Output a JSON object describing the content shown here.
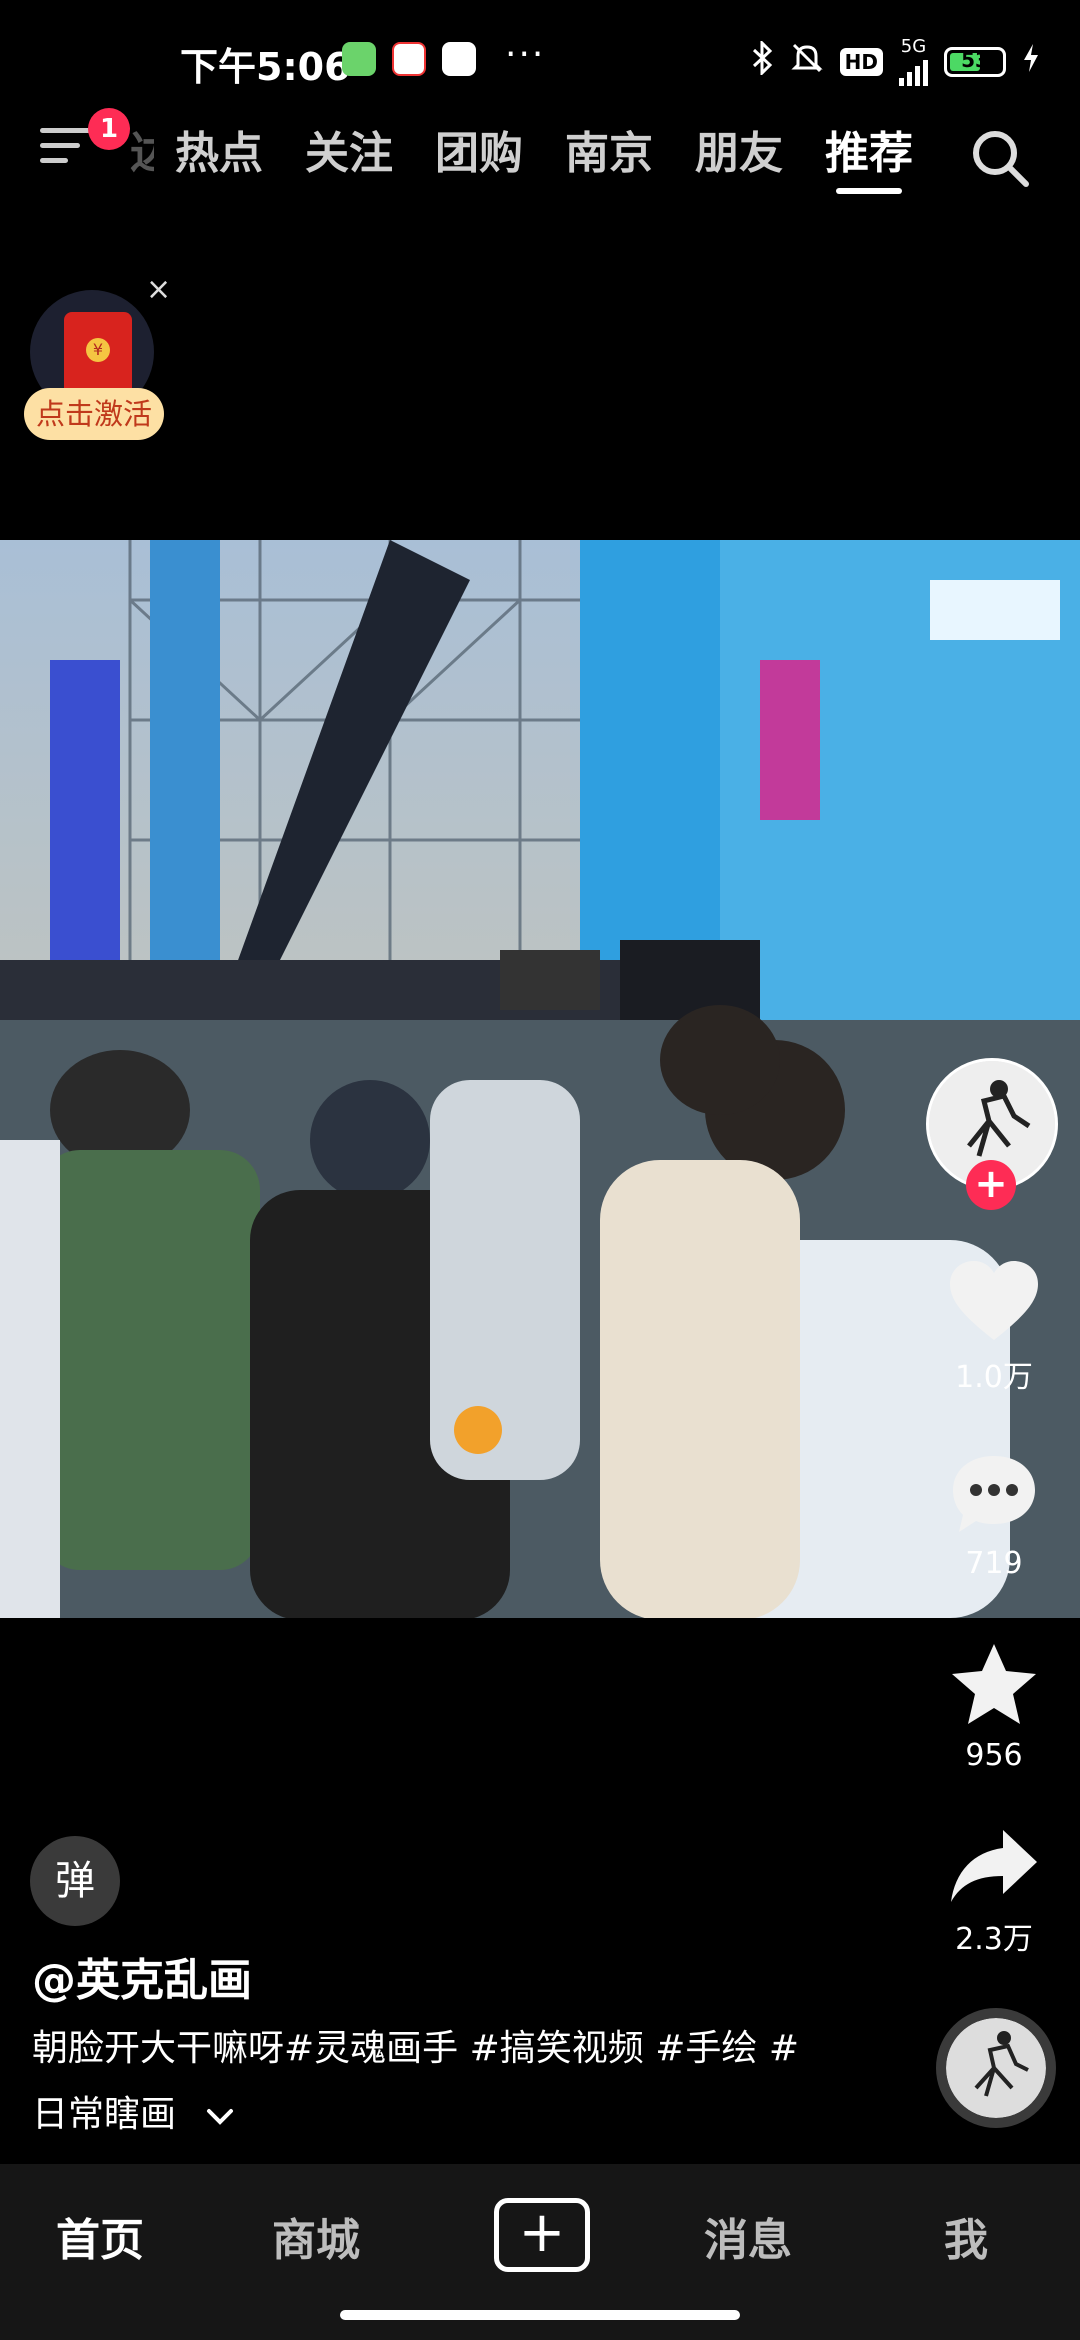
{
  "status_bar": {
    "time": "下午5:06",
    "more": "···",
    "network": "5G",
    "hd_badge": "HD",
    "battery": "53",
    "app_icons": [
      "android-green-icon",
      "58-app-icon",
      "clover-app-icon"
    ]
  },
  "top_nav": {
    "notification_count": "1",
    "partial_tab": "达",
    "tabs": [
      {
        "label": "热点",
        "active": false
      },
      {
        "label": "关注",
        "active": false
      },
      {
        "label": "团购",
        "active": false
      },
      {
        "label": "南京",
        "active": false
      },
      {
        "label": "朋友",
        "active": false
      },
      {
        "label": "推荐",
        "active": true
      }
    ]
  },
  "promo": {
    "label": "点击激活",
    "close": "×",
    "coin": "¥"
  },
  "side_actions": {
    "follow": "+",
    "likes": "1.0万",
    "comments": "719",
    "favorites": "956",
    "shares": "2.3万"
  },
  "post": {
    "danmu": "弹",
    "author": "@英克乱画",
    "description": "朝脸开大干嘛呀#灵魂画手 #搞笑视频 #手绘 #日常瞎画"
  },
  "bottom_nav": {
    "home": "首页",
    "mall": "商城",
    "create": "+",
    "messages": "消息",
    "me": "我"
  },
  "colors": {
    "accent": "#fe2c55",
    "background": "#000000",
    "bottom_bar": "#161616"
  }
}
